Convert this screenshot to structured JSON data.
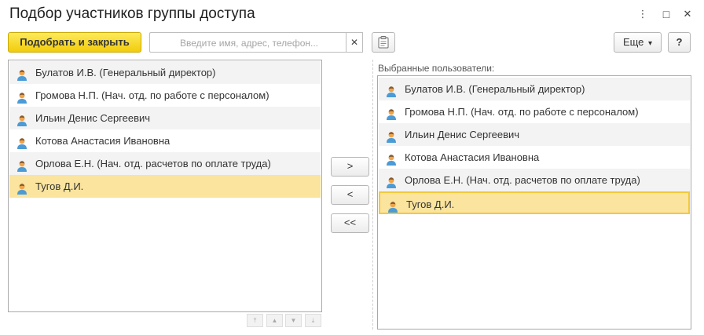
{
  "window": {
    "title": "Подбор участников группы доступа",
    "menu_icon": "⋮",
    "maximize_icon": "□",
    "close_icon": "✕"
  },
  "toolbar": {
    "select_close_label": "Подобрать и закрыть",
    "search_placeholder": "Введите имя, адрес, телефон...",
    "search_value": "",
    "clear_icon": "✕",
    "more_label": "Еще",
    "more_icon": "▾",
    "help_label": "?"
  },
  "left_list": {
    "items": [
      {
        "label": "Булатов И.В. (Генеральный директор)"
      },
      {
        "label": "Громова Н.П. (Нач. отд. по работе с персоналом)"
      },
      {
        "label": "Ильин Денис Сергеевич"
      },
      {
        "label": "Котова Анастасия Ивановна"
      },
      {
        "label": "Орлова Е.Н. (Нач. отд. расчетов по оплате труда)"
      },
      {
        "label": "Тугов Д.И.",
        "selected": true
      }
    ]
  },
  "transfer": {
    "add_label": ">",
    "remove_label": "<",
    "remove_all_label": "<<"
  },
  "right_list": {
    "heading": "Выбранные пользователи:",
    "items": [
      {
        "label": "Булатов И.В. (Генеральный директор)"
      },
      {
        "label": "Громова Н.П. (Нач. отд. по работе с персоналом)"
      },
      {
        "label": "Ильин Денис Сергеевич"
      },
      {
        "label": "Котова Анастасия Ивановна"
      },
      {
        "label": "Орлова Е.Н. (Нач. отд. расчетов по оплате труда)"
      },
      {
        "label": "Тугов Д.И.",
        "selected": true
      }
    ]
  },
  "list_nav": {
    "first_icon": "⤒",
    "up_icon": "▲",
    "down_icon": "▼",
    "last_icon": "⤓"
  },
  "colors": {
    "accent_yellow": "#f5d31a",
    "selection": "#fae49e",
    "user_icon_body": "#4a9bd6",
    "user_icon_head": "#f0a44a"
  }
}
